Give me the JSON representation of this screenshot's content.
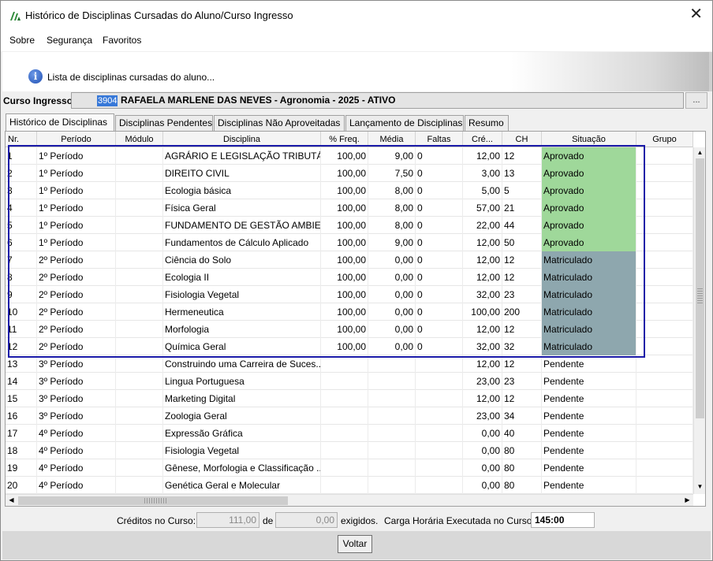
{
  "window": {
    "title": "Histórico de Disciplinas Cursadas do Aluno/Curso Ingresso",
    "close_glyph": "✕"
  },
  "menu": [
    "Sobre",
    "Segurança",
    "Favoritos"
  ],
  "info": {
    "text": "Lista de disciplinas cursadas do aluno..."
  },
  "curso": {
    "label": "Curso Ingresso:",
    "code": "3904",
    "name": "RAFAELA MARLENE DAS NEVES - Agronomia - 2025 - ATIVO",
    "ellipsis": "..."
  },
  "tabs": [
    "Histórico de Disciplinas",
    "Disciplinas Pendentes",
    "Disciplinas Não Aproveitadas",
    "Lançamento de Disciplinas",
    "Resumo"
  ],
  "grid": {
    "columns": [
      "Nr.",
      "Período",
      "Módulo",
      "Disciplina",
      "% Freq.",
      "Média",
      "Faltas",
      "Cré...",
      "CH",
      "Situação",
      "Grupo"
    ],
    "rows": [
      [
        "1",
        "1º Período",
        "",
        "AGRÁRIO E LEGISLAÇÃO TRIBUTÁRIA",
        "100,00",
        "9,00",
        "0",
        "12,00",
        "12",
        "Aprovado",
        ""
      ],
      [
        "2",
        "1º Período",
        "",
        "DIREITO CIVIL",
        "100,00",
        "7,50",
        "0",
        "3,00",
        "13",
        "Aprovado",
        ""
      ],
      [
        "3",
        "1º Período",
        "",
        "Ecologia básica",
        "100,00",
        "8,00",
        "0",
        "5,00",
        "5",
        "Aprovado",
        ""
      ],
      [
        "4",
        "1º Período",
        "",
        "Física Geral",
        "100,00",
        "8,00",
        "0",
        "57,00",
        "21",
        "Aprovado",
        ""
      ],
      [
        "5",
        "1º Período",
        "",
        "FUNDAMENTO DE GESTÃO AMBIE...",
        "100,00",
        "8,00",
        "0",
        "22,00",
        "44",
        "Aprovado",
        ""
      ],
      [
        "6",
        "1º Período",
        "",
        "Fundamentos de Cálculo Aplicado",
        "100,00",
        "9,00",
        "0",
        "12,00",
        "50",
        "Aprovado",
        ""
      ],
      [
        "7",
        "2º Período",
        "",
        "Ciência do Solo",
        "100,00",
        "0,00",
        "0",
        "12,00",
        "12",
        "Matriculado",
        ""
      ],
      [
        "8",
        "2º Período",
        "",
        "Ecologia II",
        "100,00",
        "0,00",
        "0",
        "12,00",
        "12",
        "Matriculado",
        ""
      ],
      [
        "9",
        "2º Período",
        "",
        "Fisiologia Vegetal",
        "100,00",
        "0,00",
        "0",
        "32,00",
        "23",
        "Matriculado",
        ""
      ],
      [
        "10",
        "2º Período",
        "",
        "Hermeneutica",
        "100,00",
        "0,00",
        "0",
        "100,00",
        "200",
        "Matriculado",
        ""
      ],
      [
        "11",
        "2º Período",
        "",
        "Morfologia",
        "100,00",
        "0,00",
        "0",
        "12,00",
        "12",
        "Matriculado",
        ""
      ],
      [
        "12",
        "2º Período",
        "",
        "Química Geral",
        "100,00",
        "0,00",
        "0",
        "32,00",
        "32",
        "Matriculado",
        ""
      ],
      [
        "13",
        "3º Período",
        "",
        "Construindo uma Carreira de Suces...",
        "",
        "",
        "",
        "12,00",
        "12",
        "Pendente",
        ""
      ],
      [
        "14",
        "3º Período",
        "",
        "Lingua Portuguesa",
        "",
        "",
        "",
        "23,00",
        "23",
        "Pendente",
        ""
      ],
      [
        "15",
        "3º Período",
        "",
        "Marketing Digital",
        "",
        "",
        "",
        "12,00",
        "12",
        "Pendente",
        ""
      ],
      [
        "16",
        "3º Período",
        "",
        "Zoologia Geral",
        "",
        "",
        "",
        "23,00",
        "34",
        "Pendente",
        ""
      ],
      [
        "17",
        "4º Período",
        "",
        "Expressão Gráfica",
        "",
        "",
        "",
        "0,00",
        "40",
        "Pendente",
        ""
      ],
      [
        "18",
        "4º Período",
        "",
        "Fisiologia Vegetal",
        "",
        "",
        "",
        "0,00",
        "80",
        "Pendente",
        ""
      ],
      [
        "19",
        "4º Período",
        "",
        "Gênese, Morfologia e Classificação ...",
        "",
        "",
        "",
        "0,00",
        "80",
        "Pendente",
        ""
      ],
      [
        "20",
        "4º Período",
        "",
        "Genética Geral e Molecular",
        "",
        "",
        "",
        "0,00",
        "80",
        "Pendente",
        ""
      ]
    ]
  },
  "colors": {
    "aprovado": "#9fd89a",
    "matriculado": "#8ea7ae",
    "highlight": "#1a1aa8"
  },
  "footer": {
    "creditos_label": "Créditos no Curso:",
    "creditos_value": "111,00",
    "de_label": "de",
    "exigidos_value": "0,00",
    "exigidos_label": "exigidos.",
    "carga_label": "Carga Horária Executada no Curso:",
    "carga_value": "145:00"
  },
  "buttons": {
    "voltar": "Voltar"
  }
}
